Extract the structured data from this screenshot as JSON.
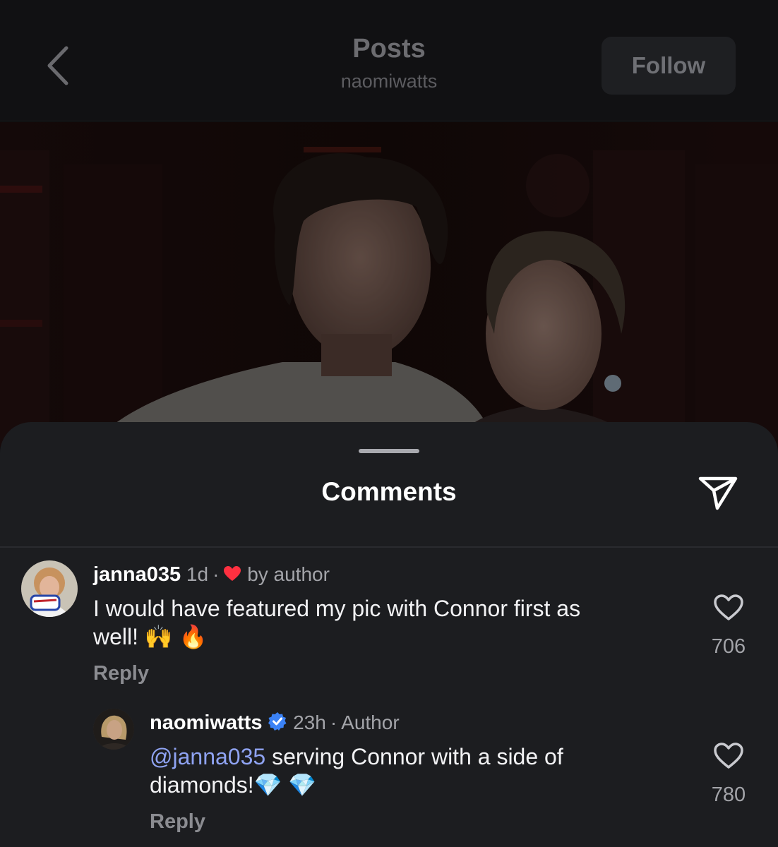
{
  "header": {
    "title": "Posts",
    "subtitle": "naomiwatts",
    "follow_label": "Follow"
  },
  "sheet": {
    "title": "Comments"
  },
  "comments": [
    {
      "username": "janna035",
      "time": "1d",
      "liked_by_author_label": "by author",
      "text_line1": "I would have featured my pic with Connor first as",
      "text_line2": "well!",
      "emoji": "🙌 🔥",
      "like_count": "706",
      "reply_label": "Reply"
    },
    {
      "username": "naomiwatts",
      "verified": true,
      "time": "23h",
      "role": "Author",
      "mention": "@janna035",
      "text_line1_rest": " serving Connor with a side of",
      "text_line2": "diamonds!",
      "emoji": "💎 💎",
      "like_count": "780",
      "reply_label": "Reply"
    }
  ],
  "colors": {
    "heart_red": "#ff3040",
    "verified_blue": "#3b82f6",
    "mention_blue": "#8fa3f2"
  },
  "icons": [
    "back-chevron-icon",
    "share-icon",
    "heart-icon",
    "verified-badge-icon",
    "heart-filled-icon"
  ]
}
